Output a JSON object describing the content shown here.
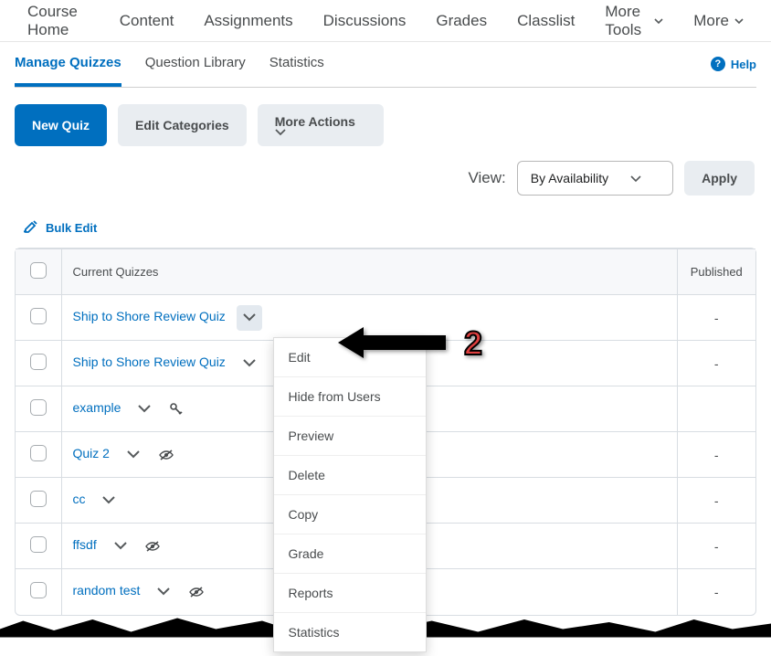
{
  "topnav": {
    "items": [
      "Course Home",
      "Content",
      "Assignments",
      "Discussions",
      "Grades",
      "Classlist",
      "More Tools",
      "More"
    ]
  },
  "subnav": {
    "tabs": [
      "Manage Quizzes",
      "Question Library",
      "Statistics"
    ],
    "help": "Help"
  },
  "actions": {
    "new_quiz": "New Quiz",
    "edit_categories": "Edit Categories",
    "more_actions": "More Actions"
  },
  "view": {
    "label": "View:",
    "selected": "By Availability",
    "apply": "Apply"
  },
  "bulk_edit": "Bulk Edit",
  "table": {
    "headers": {
      "name": "Current Quizzes",
      "published": "Published"
    },
    "rows": [
      {
        "name": "Ship to Shore Review Quiz",
        "published": "-",
        "open": true,
        "icon": null
      },
      {
        "name": "Ship to Shore Review Quiz",
        "published": "-",
        "open": false,
        "icon": null
      },
      {
        "name": "example",
        "published": "",
        "open": false,
        "icon": "key"
      },
      {
        "name": "Quiz 2",
        "published": "-",
        "open": false,
        "icon": "eye-slash"
      },
      {
        "name": "cc",
        "published": "-",
        "open": false,
        "icon": null
      },
      {
        "name": "ffsdf",
        "published": "-",
        "open": false,
        "icon": "eye-slash"
      },
      {
        "name": "random test",
        "published": "-",
        "open": false,
        "icon": "eye-slash"
      }
    ]
  },
  "dropdown": {
    "items": [
      "Edit",
      "Hide from Users",
      "Preview",
      "Delete",
      "Copy",
      "Grade",
      "Reports",
      "Statistics"
    ]
  },
  "annotation": {
    "number": "2"
  }
}
